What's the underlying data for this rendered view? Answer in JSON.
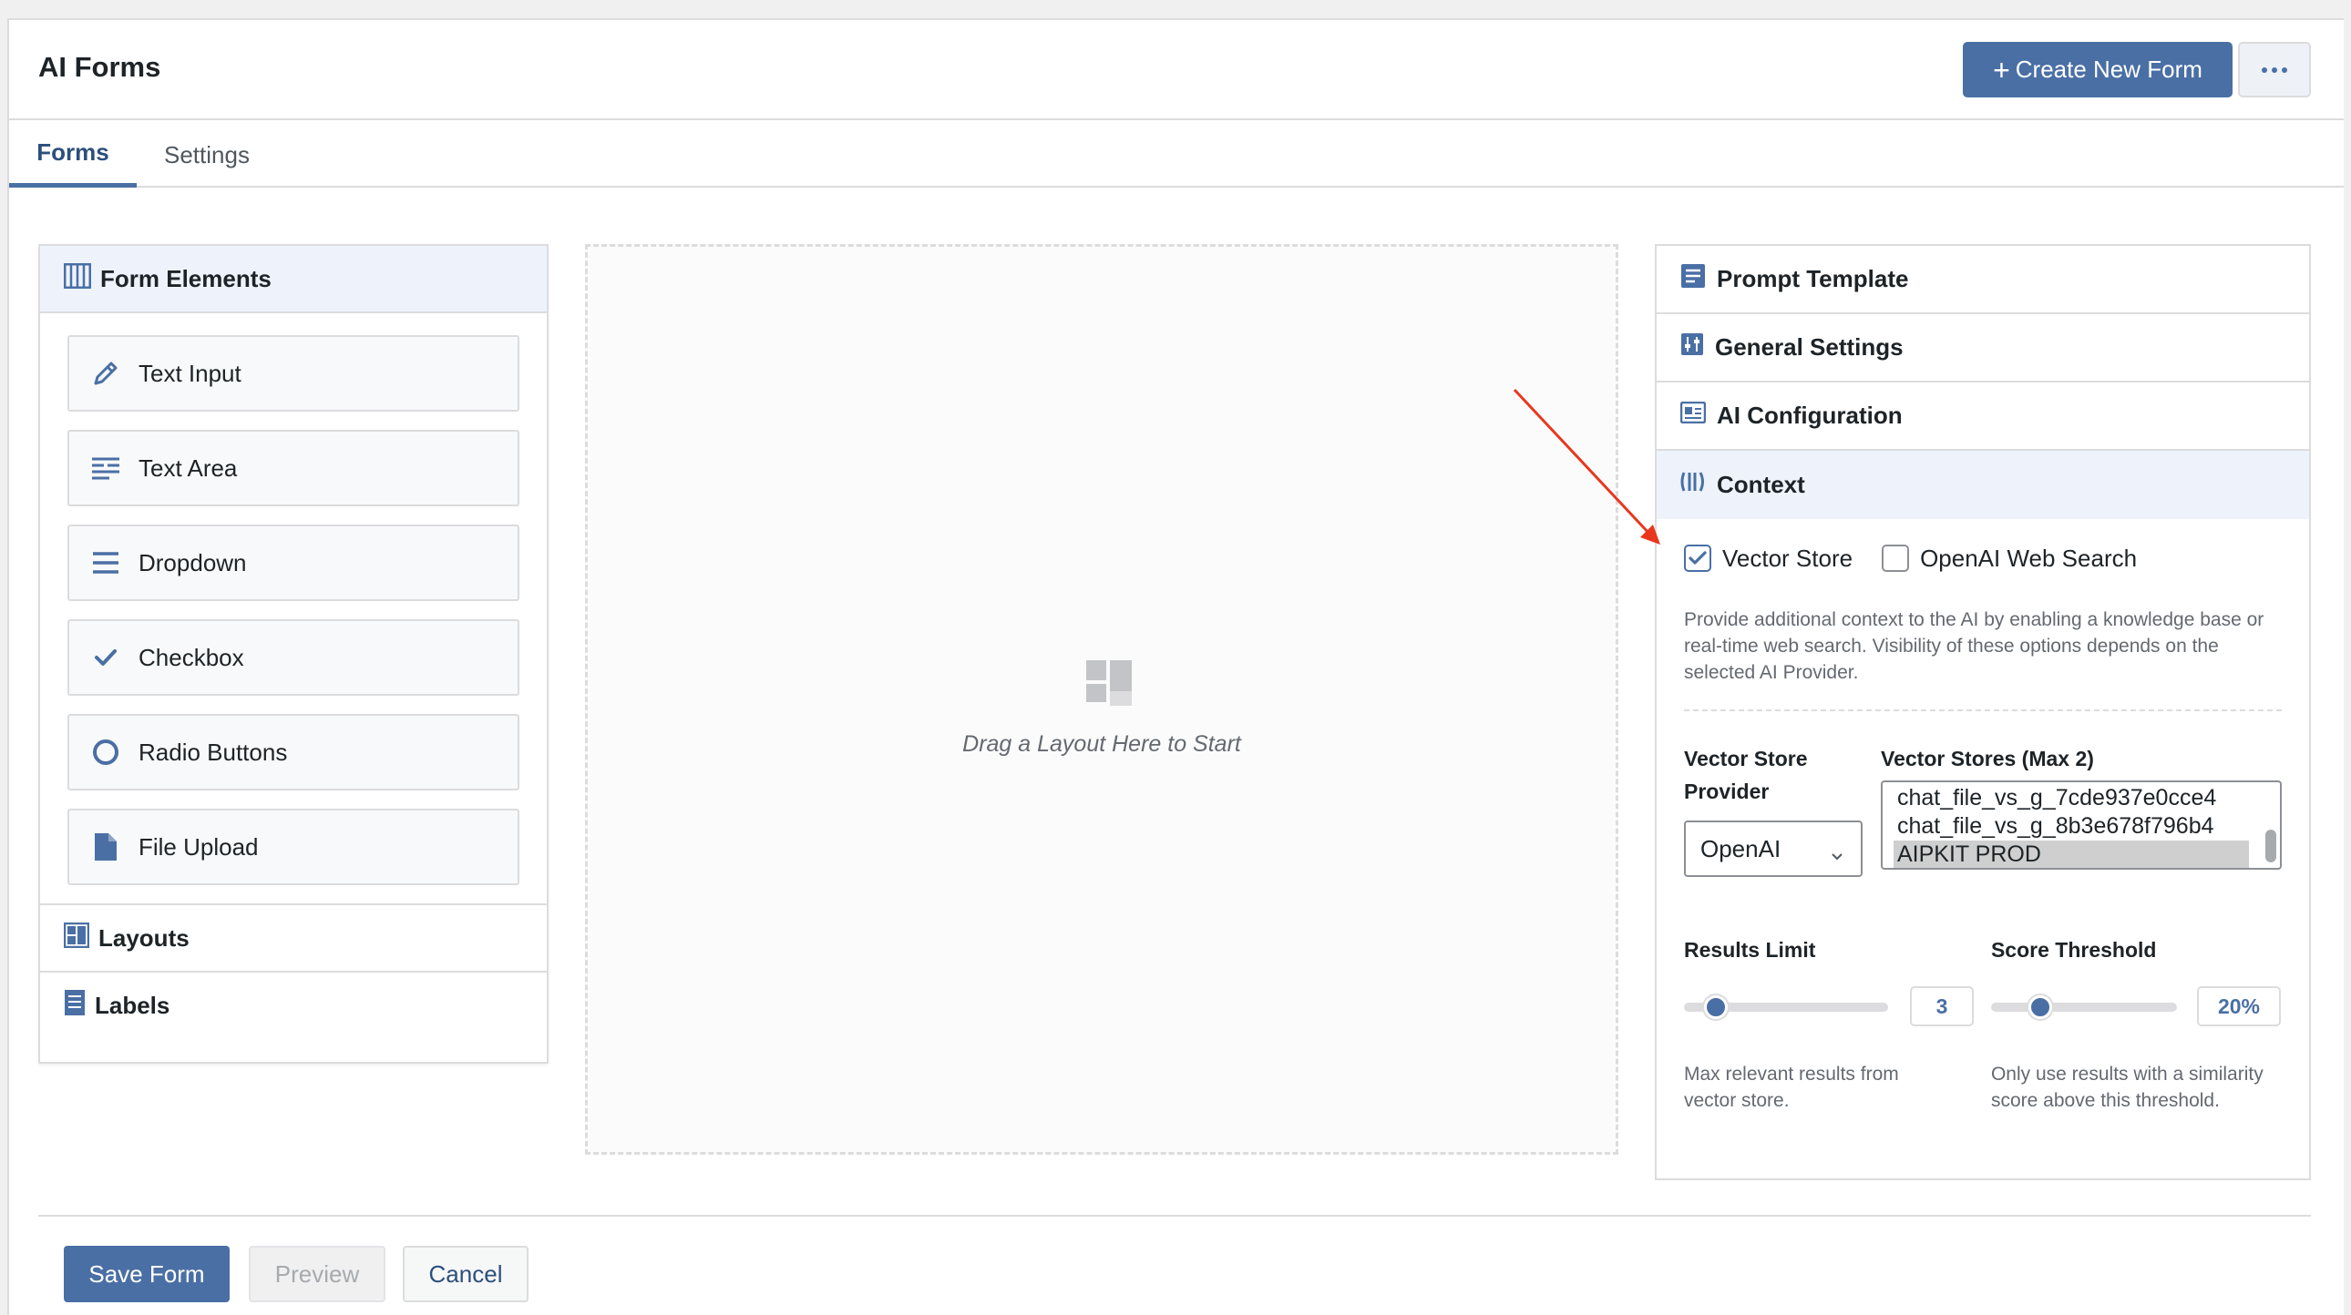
{
  "app": {
    "title": "AI Forms",
    "create_button": "Create New Form",
    "more_icon": "more-horizontal-icon",
    "accent_color": "#4a6fa5"
  },
  "tabs": [
    {
      "label": "Forms",
      "active": true
    },
    {
      "label": "Settings",
      "active": false
    }
  ],
  "form_elements": {
    "title": "Form Elements",
    "items": [
      {
        "label": "Text Input",
        "icon": "pencil-icon"
      },
      {
        "label": "Text Area",
        "icon": "text-lines-icon"
      },
      {
        "label": "Dropdown",
        "icon": "hamburger-icon"
      },
      {
        "label": "Checkbox",
        "icon": "check-icon"
      },
      {
        "label": "Radio Buttons",
        "icon": "radio-circle-icon"
      },
      {
        "label": "File Upload",
        "icon": "document-icon"
      }
    ],
    "sections": [
      {
        "label": "Layouts",
        "icon": "layout-icon"
      },
      {
        "label": "Labels",
        "icon": "label-list-icon"
      }
    ]
  },
  "canvas": {
    "placeholder": "Drag a Layout Here to Start"
  },
  "settings_panel": {
    "sections": [
      {
        "label": "Prompt Template",
        "icon": "prompt-template-icon"
      },
      {
        "label": "General Settings",
        "icon": "sliders-icon"
      },
      {
        "label": "AI Configuration",
        "icon": "ai-config-icon"
      },
      {
        "label": "Context",
        "icon": "context-icon",
        "active": true
      }
    ],
    "context": {
      "vector_store_label": "Vector Store",
      "vector_store_checked": true,
      "web_search_label": "OpenAI Web Search",
      "web_search_checked": false,
      "description": "Provide additional context to the AI by enabling a knowledge base or real-time web search. Visibility of these options depends on the selected AI Provider.",
      "provider_label_line1": "Vector Store",
      "provider_label_line2": "Provider",
      "provider_value": "OpenAI",
      "stores_label": "Vector Stores (Max 2)",
      "stores": [
        {
          "name": "chat_file_vs_g_7cde937e0cce4",
          "selected": false
        },
        {
          "name": "chat_file_vs_g_8b3e678f796b4",
          "selected": false
        },
        {
          "name": "AIPKIT PROD",
          "selected": true
        }
      ],
      "results_limit_label": "Results Limit",
      "results_limit_value": "3",
      "results_limit_fraction": 0.1,
      "results_limit_help": "Max relevant results from vector store.",
      "score_threshold_label": "Score Threshold",
      "score_threshold_value": "20%",
      "score_threshold_fraction": 0.2,
      "score_threshold_help": "Only use results with a similarity score above this threshold."
    }
  },
  "footer": {
    "save": "Save Form",
    "preview": "Preview",
    "cancel": "Cancel"
  },
  "annotation": {
    "arrow_color": "#e8371e"
  }
}
